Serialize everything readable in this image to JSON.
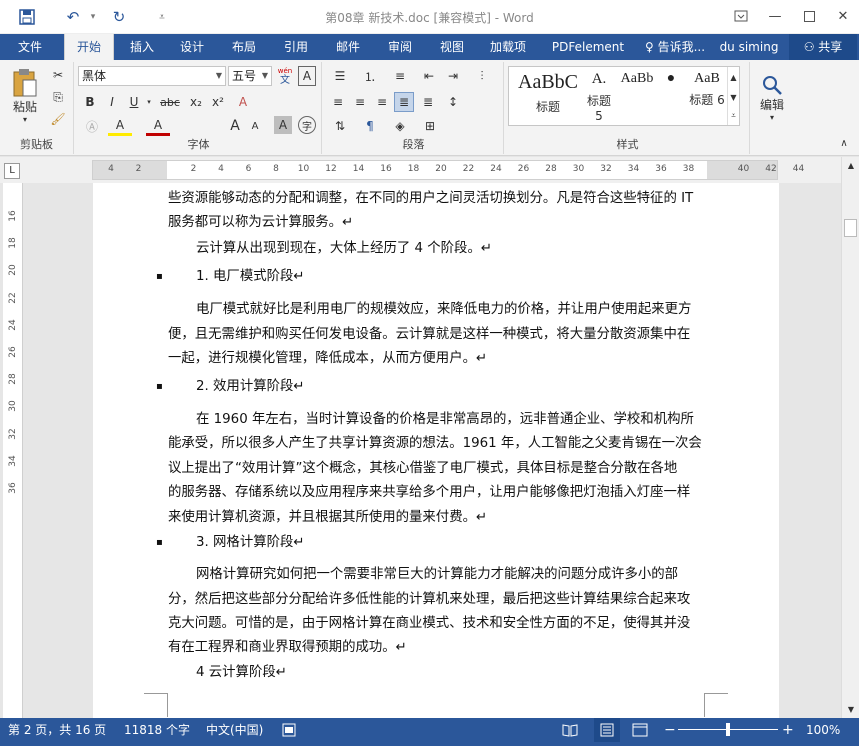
{
  "window": {
    "title": "第08章 新技术.doc [兼容模式] - Word",
    "undo_icon": "↶",
    "redo_icon": "↻",
    "save_icon": "save-icon"
  },
  "tabs": [
    {
      "label": "文件"
    },
    {
      "label": "开始"
    },
    {
      "label": "插入"
    },
    {
      "label": "设计"
    },
    {
      "label": "布局"
    },
    {
      "label": "引用"
    },
    {
      "label": "邮件"
    },
    {
      "label": "审阅"
    },
    {
      "label": "视图"
    },
    {
      "label": "加载项"
    },
    {
      "label": "PDFelement"
    }
  ],
  "tell_me": "告诉我...",
  "user": "du siming",
  "share": "共享",
  "ribbon": {
    "clipboard": {
      "paste": "粘贴",
      "label": "剪贴板"
    },
    "font": {
      "name": "黑体",
      "size": "五号",
      "label": "字体",
      "bold": "B",
      "italic": "I",
      "underline": "U",
      "strike": "abc",
      "sub": "x₂",
      "sup": "x²",
      "grow": "A",
      "shrink": "A",
      "highlight": "A",
      "fontcolor": "A",
      "wen": "wén",
      "wen_char": "文",
      "clear_format": "A",
      "char_border": "A",
      "char_shading": "A",
      "enclose": "字"
    },
    "paragraph": {
      "label": "段落"
    },
    "styles": {
      "label": "样式",
      "items": [
        {
          "sample": "AaBbC",
          "name": "标题"
        },
        {
          "sample": "A.",
          "name": "标题 5"
        },
        {
          "sample": "AaBb",
          "name": "标题 5"
        },
        {
          "sample": "●",
          "name": ""
        },
        {
          "sample": "AaB",
          "name": "标题 6"
        }
      ]
    },
    "editing": {
      "label": "编辑"
    }
  },
  "ruler": {
    "corner": "L",
    "ticks": [
      "4",
      "2",
      "",
      "2",
      "4",
      "6",
      "8",
      "10",
      "12",
      "14",
      "16",
      "18",
      "20",
      "22",
      "24",
      "26",
      "28",
      "30",
      "32",
      "34",
      "36",
      "38",
      "",
      "40",
      "42",
      "44"
    ],
    "vticks": [
      "16",
      "",
      "18",
      "",
      "20",
      "",
      "22",
      "",
      "24",
      "",
      "26",
      "",
      "28",
      "",
      "30",
      "",
      "32",
      "",
      "34",
      "",
      "36"
    ]
  },
  "document": {
    "lines": [
      {
        "text": "些资源能够动态的分配和调整，在不同的用户之间灵活切换划分。凡是符合这些特征的 IT",
        "indent": false,
        "bullet": false
      },
      {
        "text": "服务都可以称为云计算服务。↵",
        "indent": false,
        "bullet": false
      },
      {
        "text": "云计算从出现到现在，大体上经历了 4 个阶段。↵",
        "indent": true,
        "bullet": false
      },
      {
        "text": "1. 电厂模式阶段↵",
        "indent": true,
        "bullet": true
      },
      {
        "text": "电厂模式就好比是利用电厂的规模效应，来降低电力的价格，并让用户使用起来更方",
        "indent": true,
        "bullet": false
      },
      {
        "text": "便，且无需维护和购买任何发电设备。云计算就是这样一种模式，将大量分散资源集中在",
        "indent": false,
        "bullet": false
      },
      {
        "text": "一起，进行规模化管理，降低成本，从而方便用户。↵",
        "indent": false,
        "bullet": false
      },
      {
        "text": "2. 效用计算阶段↵",
        "indent": true,
        "bullet": true
      },
      {
        "text": "在 1960 年左右，当时计算设备的价格是非常高昂的，远非普通企业、学校和机构所",
        "indent": true,
        "bullet": false
      },
      {
        "text": "能承受，所以很多人产生了共享计算资源的想法。1961 年，人工智能之父麦肯锡在一次会",
        "indent": false,
        "bullet": false
      },
      {
        "text": "议上提出了“效用计算”这个概念，其核心借鉴了电厂模式，具体目标是整合分散在各地",
        "indent": false,
        "bullet": false
      },
      {
        "text": "的服务器、存储系统以及应用程序来共享给多个用户，让用户能够像把灯泡插入灯座一样",
        "indent": false,
        "bullet": false
      },
      {
        "text": "来使用计算机资源，并且根据其所使用的量来付费。↵",
        "indent": false,
        "bullet": false
      },
      {
        "text": "3. 网格计算阶段↵",
        "indent": true,
        "bullet": true
      },
      {
        "text": "网格计算研究如何把一个需要非常巨大的计算能力才能解决的问题分成许多小的部",
        "indent": true,
        "bullet": false
      },
      {
        "text": "分，然后把这些部分分配给许多低性能的计算机来处理，最后把这些计算结果综合起来攻",
        "indent": false,
        "bullet": false
      },
      {
        "text": "克大问题。可惜的是，由于网格计算在商业模式、技术和安全性方面的不足，使得其并没",
        "indent": false,
        "bullet": false
      },
      {
        "text": "有在工程界和商业界取得预期的成功。↵",
        "indent": false,
        "bullet": false
      },
      {
        "text": "4  云计算阶段↵",
        "indent": true,
        "bullet": false
      }
    ]
  },
  "status": {
    "page": "第 2 页，共 16 页",
    "words": "11818 个字",
    "lang": "中文(中国)",
    "zoom": "100%",
    "zoom_out": "−",
    "zoom_in": "+"
  },
  "colors": {
    "accent": "#2b579a",
    "ribbon": "#f3f3f3",
    "doc_bg": "#e6e6e6"
  }
}
